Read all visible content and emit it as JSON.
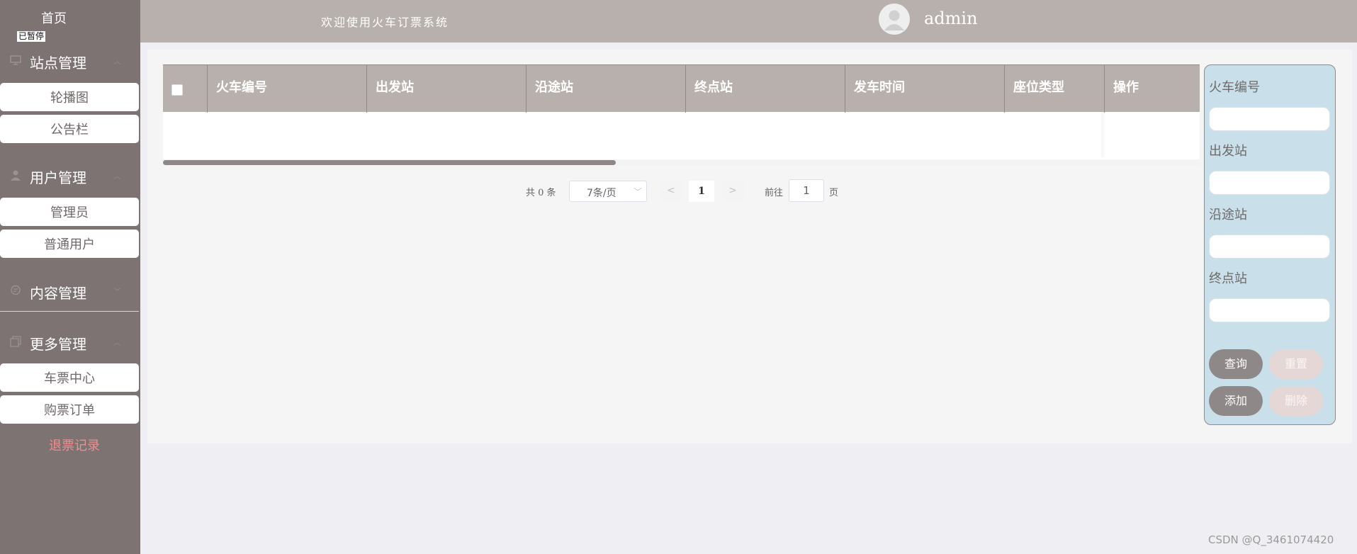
{
  "sidebar": {
    "home": "首页",
    "paused": "已暂停",
    "groups": [
      {
        "label": "站点管理",
        "icon": "monitor-icon",
        "items": [
          "轮播图",
          "公告栏"
        ]
      },
      {
        "label": "用户管理",
        "icon": "user-icon",
        "items": [
          "管理员",
          "普通用户"
        ]
      },
      {
        "label": "内容管理",
        "icon": "chat-icon",
        "items": []
      },
      {
        "label": "更多管理",
        "icon": "copy-icon",
        "items": [
          "车票中心",
          "购票订单",
          "退票记录"
        ]
      }
    ]
  },
  "header": {
    "welcome": "欢迎使用火车订票系统",
    "username": "admin",
    "avatar_icon": "user-avatar-icon"
  },
  "table": {
    "columns": [
      "火车编号",
      "出发站",
      "沿途站",
      "终点站",
      "发车时间",
      "座位类型",
      "操作"
    ],
    "rows": []
  },
  "pagination": {
    "total": "共 0 条",
    "page_size": "7条/页",
    "prev": "<",
    "current": "1",
    "next": ">",
    "goto_label": "前往",
    "goto_value": "1",
    "goto_unit": "页"
  },
  "search": {
    "fields": [
      {
        "label": "火车编号",
        "value": ""
      },
      {
        "label": "出发站",
        "value": ""
      },
      {
        "label": "沿途站",
        "value": ""
      },
      {
        "label": "终点站",
        "value": ""
      }
    ],
    "buttons": {
      "query": "查询",
      "reset": "重置",
      "add": "添加",
      "delete": "删除"
    }
  },
  "watermark": "CSDN @Q_3461074420",
  "colors": {
    "sidebar_bg": "#7d7373",
    "header_bg": "#b7b0ad",
    "search_panel_bg": "#c9dfe9",
    "active_menu_text": "#f08d8d",
    "primary_button": "#8f8888",
    "disabled_button": "#e6d7d7"
  }
}
